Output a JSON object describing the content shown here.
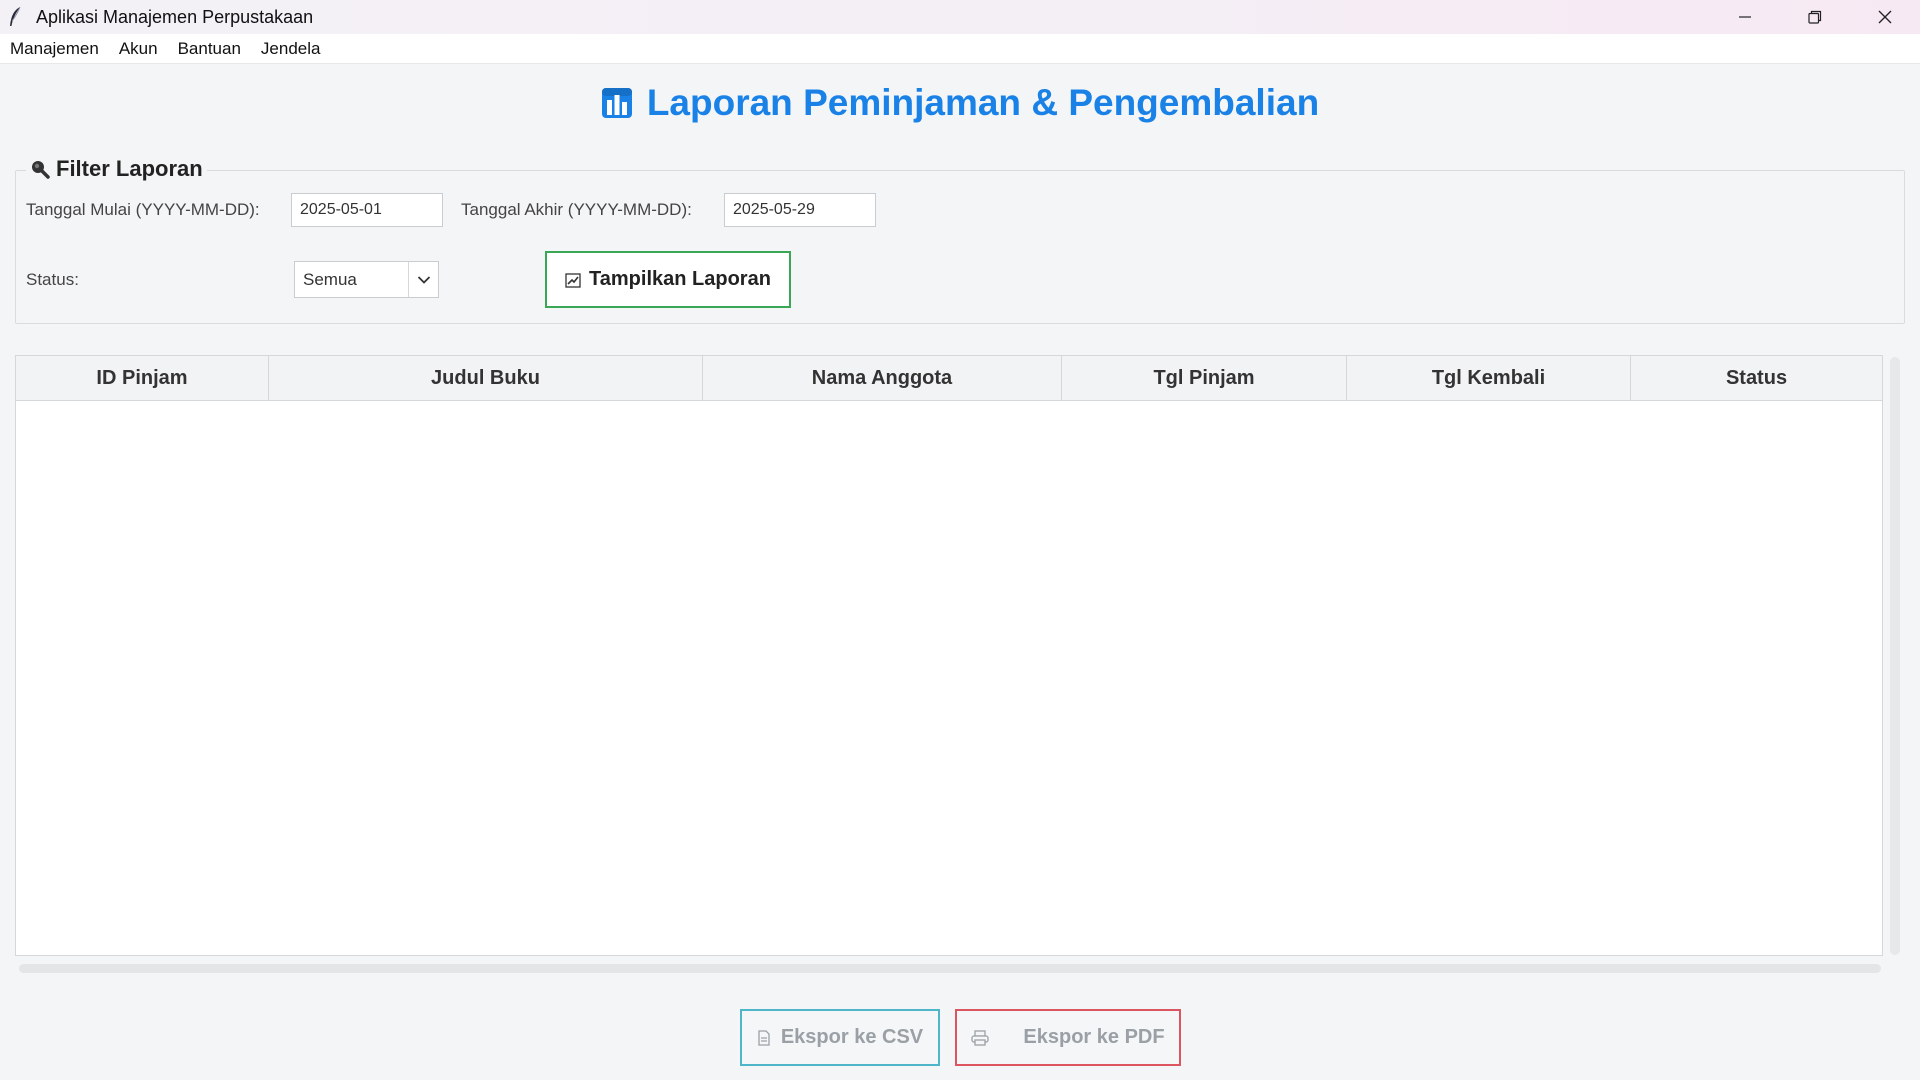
{
  "window": {
    "title": "Aplikasi Manajemen Perpustakaan"
  },
  "menu": [
    "Manajemen",
    "Akun",
    "Bantuan",
    "Jendela"
  ],
  "page": {
    "heading": "Laporan Peminjaman & Pengembalian",
    "accent_color": "#1a82e6"
  },
  "filter": {
    "legend": "Filter Laporan",
    "start_label": "Tanggal Mulai (YYYY-MM-DD):",
    "start_value": "2025-05-01",
    "end_label": "Tanggal Akhir (YYYY-MM-DD):",
    "end_value": "2025-05-29",
    "status_label": "Status:",
    "status_value": "Semua",
    "show_button": "Tampilkan Laporan",
    "show_button_border": "#3aa757"
  },
  "table": {
    "columns": [
      "ID Pinjam",
      "Judul Buku",
      "Nama Anggota",
      "Tgl Pinjam",
      "Tgl Kembali",
      "Status"
    ],
    "rows": []
  },
  "export": {
    "csv_label": "Ekspor ke CSV",
    "pdf_label": "Ekspor ke PDF",
    "csv_border": "#4fb6c9",
    "pdf_border": "#dd5561"
  },
  "icons": {
    "app": "feather-icon",
    "heading": "chart-icon",
    "filter": "magnifier-icon",
    "show": "chart-small-icon",
    "csv": "document-icon",
    "pdf": "printer-icon"
  }
}
